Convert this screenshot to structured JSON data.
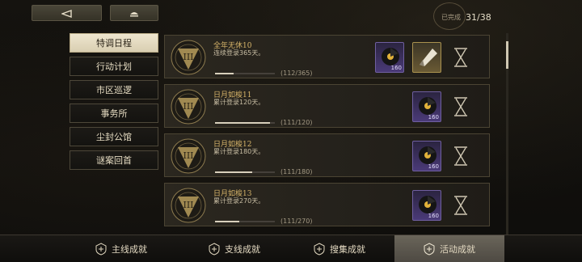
{
  "header": {
    "back_icon": "back-arrow-icon",
    "home_icon": "home-icon",
    "completion_label": "已完成",
    "completion_count": "31/38"
  },
  "sidebar": {
    "items": [
      {
        "label": "特调日程",
        "active": true
      },
      {
        "label": "行动计划",
        "active": false
      },
      {
        "label": "市区巡逻",
        "active": false
      },
      {
        "label": "事务所",
        "active": false
      },
      {
        "label": "尘封公馆",
        "active": false
      },
      {
        "label": "谜案回首",
        "active": false
      }
    ]
  },
  "achievements": [
    {
      "title": "全年无休10",
      "desc": "连续登录365天。",
      "progress_text": "(112/365)",
      "progress": 0.307,
      "rewards": [
        {
          "icon": "record-disc-icon",
          "qty": "160",
          "style": "purple"
        },
        {
          "icon": "folded-card-icon",
          "qty": "",
          "style": "gold"
        }
      ]
    },
    {
      "title": "日月如梭11",
      "desc": "累计登录120天。",
      "progress_text": "(111/120)",
      "progress": 0.925,
      "rewards": [
        {
          "icon": "record-disc-icon",
          "qty": "160",
          "style": "purple"
        }
      ]
    },
    {
      "title": "日月如梭12",
      "desc": "累计登录180天。",
      "progress_text": "(111/180)",
      "progress": 0.617,
      "rewards": [
        {
          "icon": "record-disc-icon",
          "qty": "160",
          "style": "purple"
        }
      ]
    },
    {
      "title": "日月如梭13",
      "desc": "累计登录270天。",
      "progress_text": "(111/270)",
      "progress": 0.411,
      "rewards": [
        {
          "icon": "record-disc-icon",
          "qty": "160",
          "style": "purple"
        }
      ]
    }
  ],
  "bottom_nav": {
    "tabs": [
      {
        "label": "主线成就",
        "icon": "main-line-icon",
        "active": false
      },
      {
        "label": "支线成就",
        "icon": "side-line-icon",
        "active": false
      },
      {
        "label": "搜集成就",
        "icon": "collection-icon",
        "active": false
      },
      {
        "label": "活动成就",
        "icon": "activity-icon",
        "active": true
      }
    ]
  },
  "colors": {
    "accent_gold": "#d7b56a",
    "reward_purple": "#4a3a78",
    "active_tab": "#6a655a"
  }
}
